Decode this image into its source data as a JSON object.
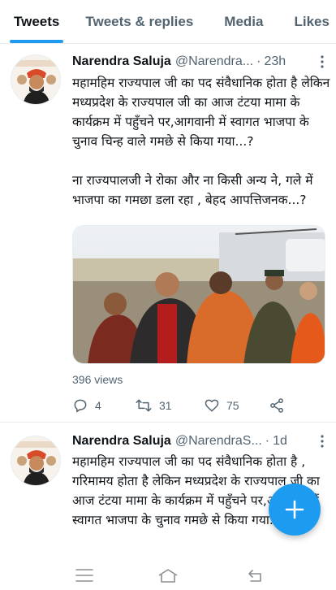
{
  "tabs": [
    {
      "label": "Tweets",
      "active": true
    },
    {
      "label": "Tweets & replies",
      "active": false
    },
    {
      "label": "Media",
      "active": false
    },
    {
      "label": "Likes",
      "active": false
    }
  ],
  "tweets": [
    {
      "name": "Narendra Saluja",
      "handle": "@Narendra...",
      "dot": "·",
      "time": "23h",
      "paragraphs": [
        "महामहिम राज्यपाल जी का पद संवैधानिक होता है लेकिन मध्यप्रदेश के राज्यपाल जी का आज टंटया मामा के कार्यक्रम में पहुँचने पर,आगवानी में स्वागत भाजपा के चुनाव चिन्ह वाले गमछे से किया गया...?",
        "ना राज्यपालजी ने रोका और ना किसी अन्य ने, गले में भाजपा का गमछा डला रहा , बेहद आपत्तिजनक...?"
      ],
      "views": "396 views",
      "stats": {
        "replies": "4",
        "retweets": "31",
        "likes": "75"
      }
    },
    {
      "name": "Narendra Saluja",
      "handle": "@NarendraS...",
      "dot": "·",
      "time": "1d",
      "paragraphs": [
        "महामहिम राज्यपाल जी का पद संवैधानिक होता है , गरिमामय होता है लेकिन मध्यप्रदेश के राज्यपाल जी का आज टंटया मामा के कार्यक्रम में पहुँचने पर,आगवानी में स्वागत भाजपा के चुनाव गमछे से किया गया..?"
      ]
    }
  ],
  "colors": {
    "accent": "#1d9bf0",
    "text": "#0f1419",
    "muted": "#536471"
  },
  "icons": {
    "more": "more-vertical-icon",
    "reply": "reply-icon",
    "retweet": "retweet-icon",
    "like": "heart-icon",
    "share": "share-icon",
    "compose": "plus-icon",
    "nav_menu": "menu-icon",
    "nav_home": "home-icon",
    "nav_back": "back-icon"
  }
}
